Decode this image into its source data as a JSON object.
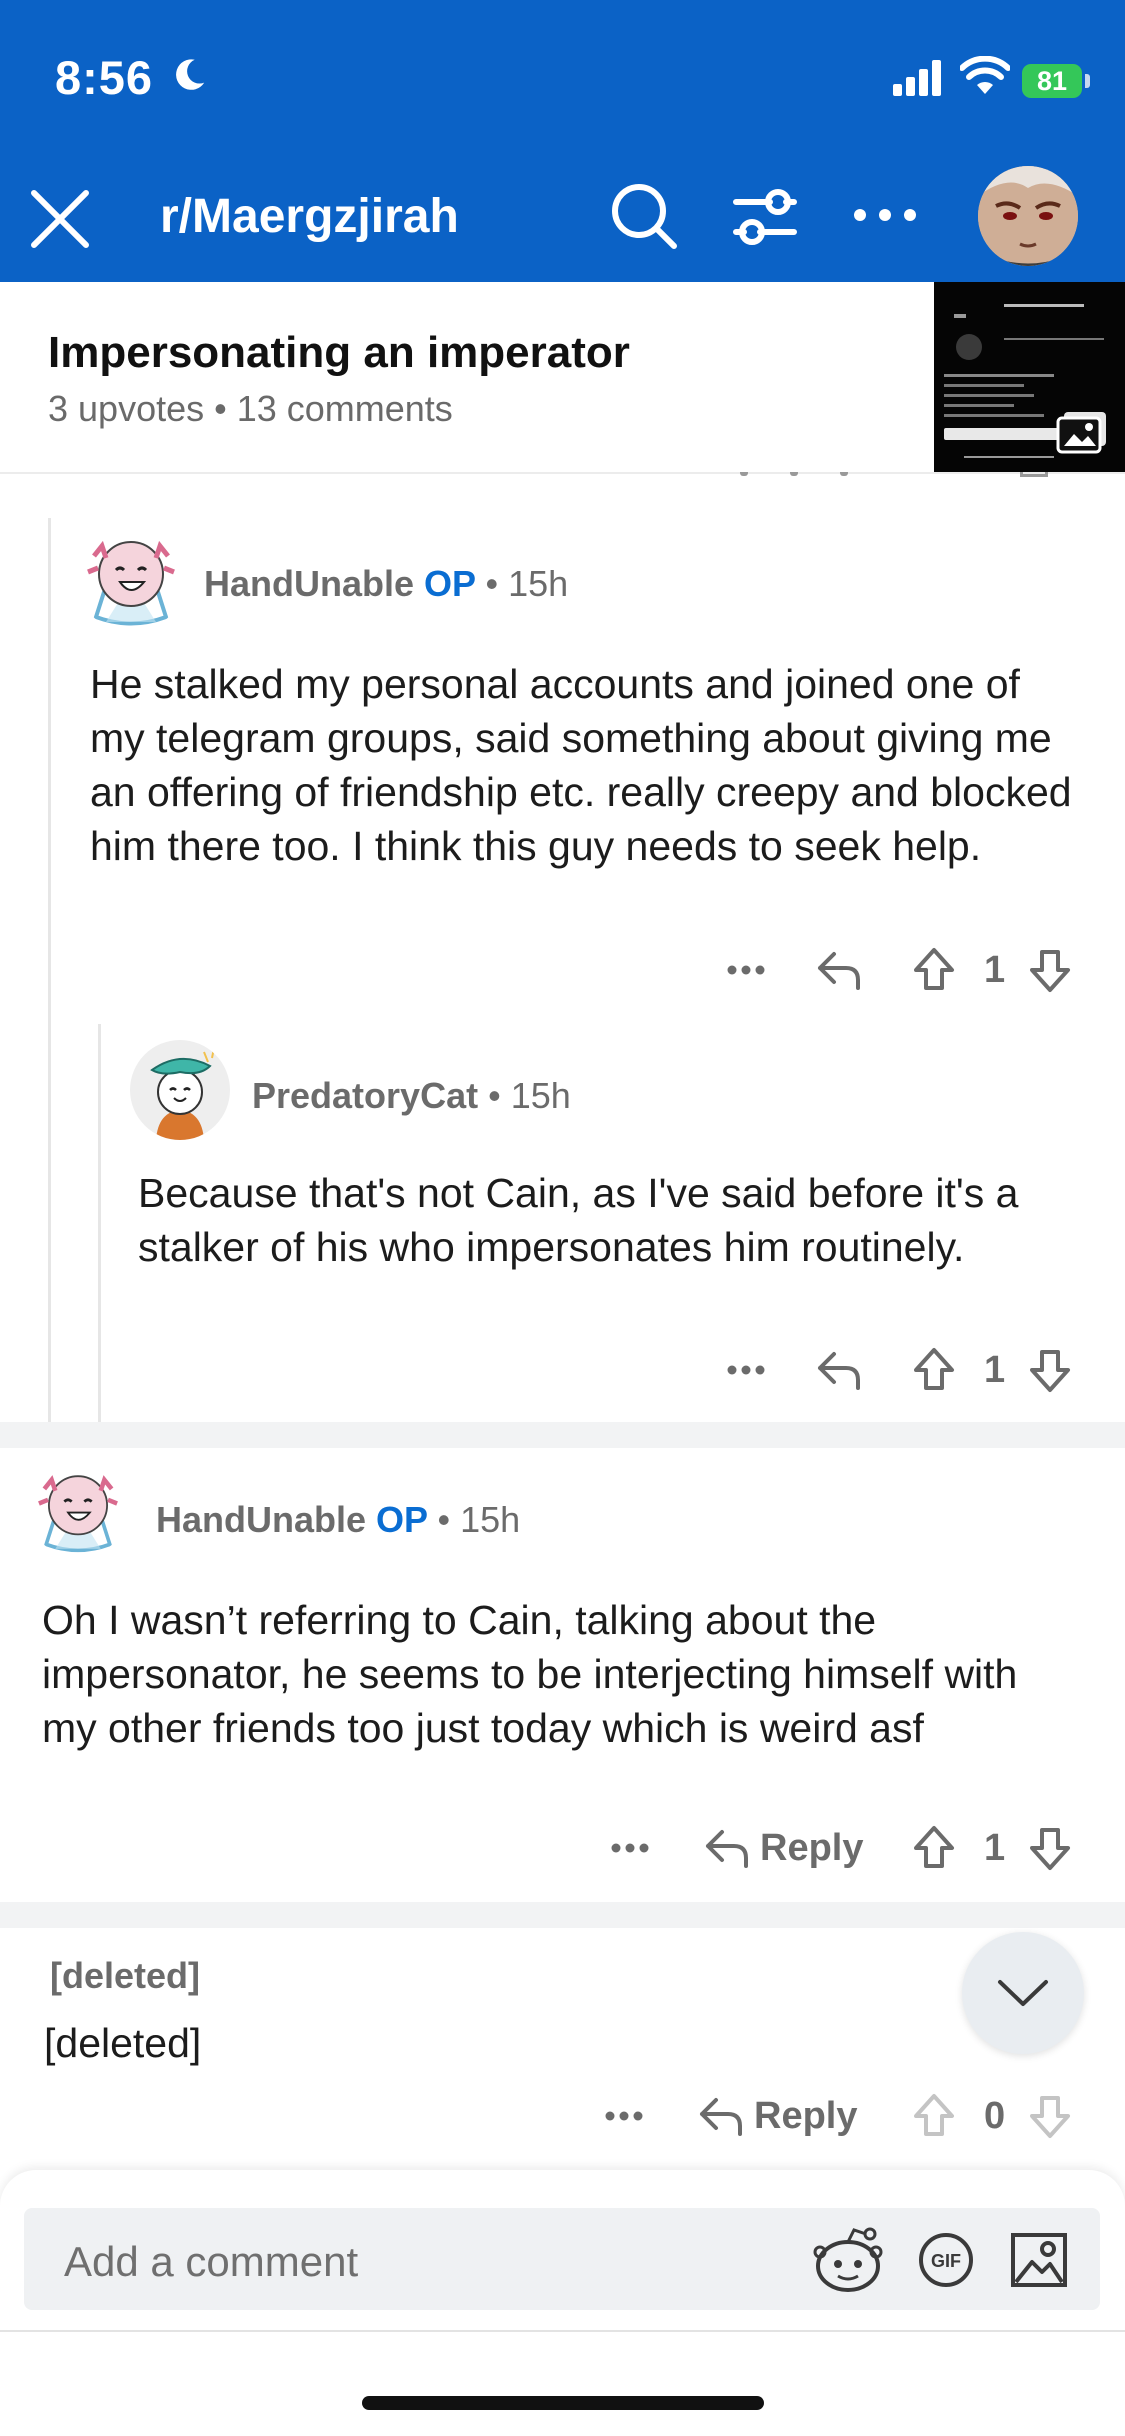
{
  "status_bar": {
    "time": "8:56",
    "battery": "81"
  },
  "nav": {
    "title": "r/Maergzjirah"
  },
  "post": {
    "title": "Impersonating an imperator",
    "meta": "3 upvotes • 13 comments"
  },
  "comments": [
    {
      "username": "HandUnable",
      "op_label": "OP",
      "age": "15h",
      "body": "He stalked my personal accounts and joined one of my telegram groups, said something about giving me an offering of friendship etc. really creepy and blocked him there too. I think this guy needs to seek help.",
      "score": "1"
    },
    {
      "username": "PredatoryCat",
      "age": "15h",
      "body": "Because that's not Cain, as I've said before it's a stalker of his who impersonates him routinely.",
      "score": "1"
    },
    {
      "username": "HandUnable",
      "op_label": "OP",
      "age": "15h",
      "body": "Oh I wasn’t referring to Cain, talking about the impersonator, he seems to be interjecting himself with my other friends too just today which is weird asf",
      "reply_label": "Reply",
      "score": "1"
    },
    {
      "username": "[deleted]",
      "body": "[deleted]",
      "reply_label": "Reply",
      "score": "0"
    }
  ],
  "composer": {
    "placeholder": "Add a comment"
  },
  "colors": {
    "brand_blue": "#0b62c6",
    "op_blue": "#0a6dd2",
    "battery_green": "#34c759"
  },
  "icons": [
    "moon-icon",
    "signal-icon",
    "wifi-icon",
    "close-icon",
    "search-icon",
    "filter-icon",
    "more-icon",
    "reply-icon",
    "upvote-icon",
    "downvote-icon",
    "chevron-down-icon",
    "snoo-icon",
    "gif-icon",
    "image-icon"
  ]
}
